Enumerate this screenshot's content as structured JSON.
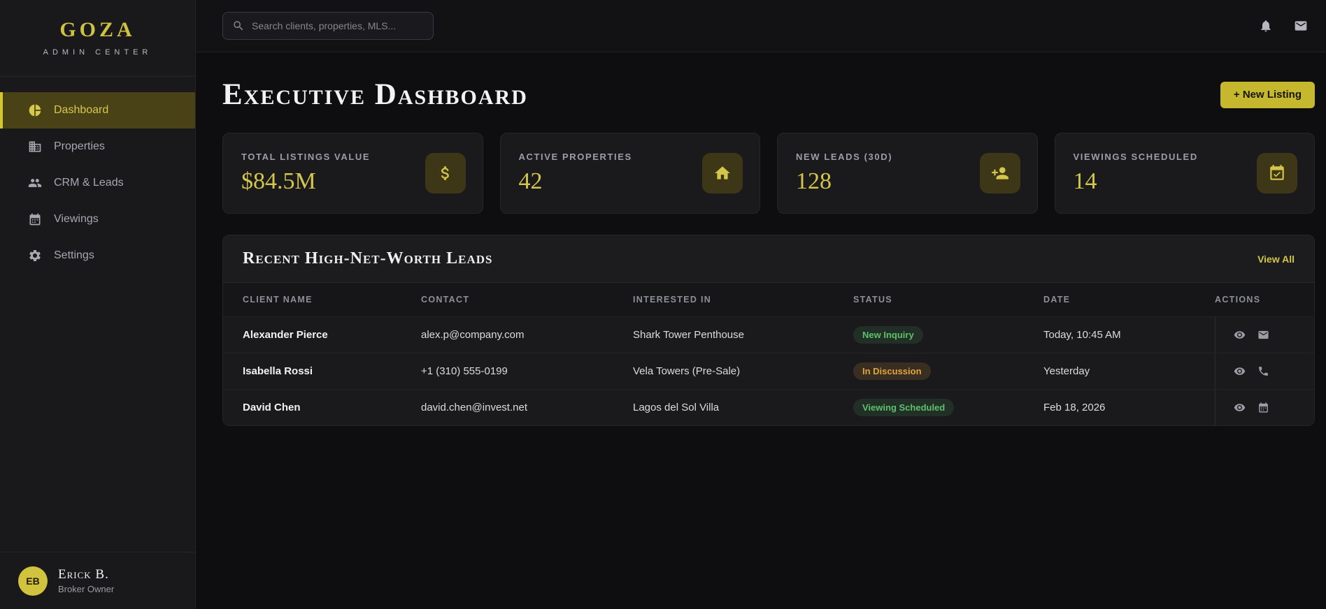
{
  "brand": {
    "name": "GOZA",
    "subtitle": "ADMIN CENTER"
  },
  "topbar": {
    "search_placeholder": "Search clients, properties, MLS...",
    "icons": [
      "bell",
      "mail"
    ]
  },
  "sidebar": {
    "items": [
      {
        "label": "Dashboard",
        "icon": "pie-chart",
        "state": "active"
      },
      {
        "label": "Properties",
        "icon": "building",
        "state": ""
      },
      {
        "label": "CRM & Leads",
        "icon": "people",
        "state": ""
      },
      {
        "label": "Viewings",
        "icon": "calendar",
        "state": ""
      },
      {
        "label": "Settings",
        "icon": "gear",
        "state": ""
      }
    ],
    "user": {
      "initials": "EB",
      "name": "Erick B.",
      "role": "Broker Owner"
    }
  },
  "header": {
    "title": "Executive Dashboard",
    "new_listing_label": "+ New Listing"
  },
  "stats": [
    {
      "label": "TOTAL LISTINGS VALUE",
      "value": "$84.5M",
      "icon": "dollar"
    },
    {
      "label": "ACTIVE PROPERTIES",
      "value": "42",
      "icon": "home"
    },
    {
      "label": "NEW LEADS (30D)",
      "value": "128",
      "icon": "person-add"
    },
    {
      "label": "VIEWINGS SCHEDULED",
      "value": "14",
      "icon": "calendar-check"
    }
  ],
  "leads": {
    "title": "Recent High-Net-Worth Leads",
    "view_all_label": "View All",
    "columns": [
      "CLIENT NAME",
      "CONTACT",
      "INTERESTED IN",
      "STATUS",
      "DATE",
      "ACTIONS"
    ],
    "rows": [
      {
        "client": "Alexander Pierce",
        "contact": "alex.p@company.com",
        "interested_in": "Shark Tower Penthouse",
        "status": "New Inquiry",
        "status_type": "green",
        "date": "Today, 10:45 AM",
        "actions": [
          "eye",
          "mail"
        ]
      },
      {
        "client": "Isabella Rossi",
        "contact": "+1 (310) 555-0199",
        "interested_in": "Vela Towers (Pre-Sale)",
        "status": "In Discussion",
        "status_type": "amber",
        "date": "Yesterday",
        "actions": [
          "eye",
          "phone"
        ]
      },
      {
        "client": "David Chen",
        "contact": "david.chen@invest.net",
        "interested_in": "Lagos del Sol Villa",
        "status": "Viewing Scheduled",
        "status_type": "green",
        "date": "Feb 18, 2026",
        "actions": [
          "eye",
          "calendar"
        ]
      }
    ]
  },
  "colors": {
    "accent_gold": "#d4c64a",
    "button_gold": "#c5b72e",
    "status_green": "#5ec06a",
    "status_amber": "#e2a43c",
    "sidebar_bg": "#19191c",
    "card_bg": "#1a1a1d",
    "main_bg": "#0e0e10"
  }
}
